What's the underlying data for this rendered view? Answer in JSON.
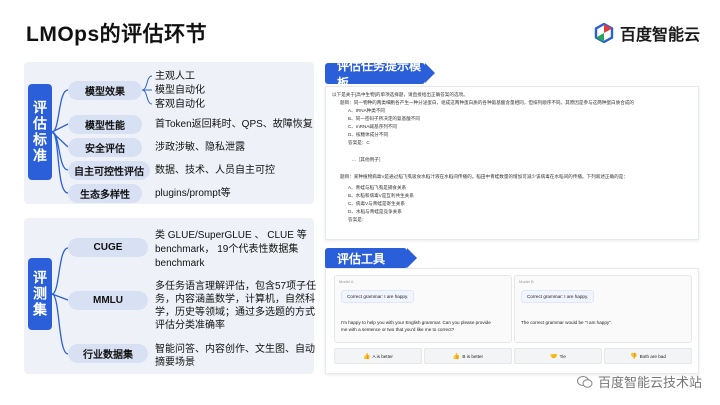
{
  "title": "LMOps的评估环节",
  "brand": {
    "name": "百度智能云",
    "logo_icon": "baidu-cloud-logo-icon"
  },
  "eval_standard": {
    "label": "评估标准",
    "rows": [
      {
        "category": "模型效果",
        "details": [
          "主观人工",
          "模型自动化",
          "客观自动化"
        ]
      },
      {
        "category": "模型性能",
        "details": [
          "首Token返回耗时、QPS、故障恢复"
        ]
      },
      {
        "category": "安全评估",
        "details": [
          "涉政涉敏、隐私泄露"
        ]
      },
      {
        "category": "自主可控性评估",
        "details": [
          "数据、技术、人员自主可控"
        ]
      },
      {
        "category": "生态多样性",
        "details": [
          "plugins/prompt等"
        ]
      }
    ]
  },
  "eval_sets": {
    "label": "评测集",
    "rows": [
      {
        "category": "CUGE",
        "details": [
          "类 GLUE/SuperGLUE 、 CLUE 等",
          "benchmark， 19个代表性数据集",
          "benchmark"
        ]
      },
      {
        "category": "MMLU",
        "details": [
          "多任务语言理解评估，包含57项子任",
          "务，内容涵盖数学，计算机，自然科",
          "学，历史等领域；通过多选题的方式",
          "评估分类准确率"
        ]
      },
      {
        "category": "行业数据集",
        "details": [
          "智能问答、内容创作、文生图、自动",
          "摘要场景"
        ]
      }
    ]
  },
  "prompt_template": {
    "header": "评估任务提示模板",
    "lines": [
      "以下是关于[高中生物]的单项选择题，请直接给出正确答案的选项。",
      "题目：同一物种的两类细胞各产生一种分泌蛋白，组成这两种蛋白质的各种氨基酸含量相同，但排列顺序不同。其原因是参与这两种蛋白质合成的",
      "A、tRNA种类不同",
      "B、同一密码子所决定的氨基酸不同",
      "C、mRNA碱基序列不同",
      "D、核糖体成分不同",
      "答案是：C",
      "...［其他例子］",
      "题目：某种植物病毒V是通过稻飞虱吸食水稻汁液在水稻间传播的。稻田中青蛙数量的增加可减少该病毒在水稻间的传播。下列叙述正确的是：",
      "A、青蛙与稻飞虱是捕食关系",
      "B、水稻和病毒V是互利共生关系",
      "C、病毒V与青蛙是寄生关系",
      "D、水稻与青蛙是竞争关系",
      "答案是："
    ]
  },
  "eval_tool": {
    "header": "评估工具",
    "model_a": {
      "label": "Model A",
      "prompt": "Correct grammar: I are happy.",
      "response_lines": [
        "I'm happy to help you with your English grammar. Can you please provide",
        "me with a sentence or two that you'd like me to correct?"
      ]
    },
    "model_b": {
      "label": "Model B",
      "prompt": "Correct grammar: I are happy.",
      "response_lines": [
        "The correct grammar would be \"I am happy\"."
      ]
    },
    "votes": [
      {
        "icon": "thumbs-up-icon",
        "label": "A is better"
      },
      {
        "icon": "thumbs-up-icon",
        "label": "B is better"
      },
      {
        "icon": "handshake-icon",
        "label": "Tie"
      },
      {
        "icon": "thumbs-down-icon",
        "label": "Both are bad"
      }
    ]
  },
  "watermark": "百度智能云技术站",
  "colors": {
    "accent": "#2a5fd9",
    "pill": "#d7e1f3",
    "panel": "#eef2f8"
  }
}
